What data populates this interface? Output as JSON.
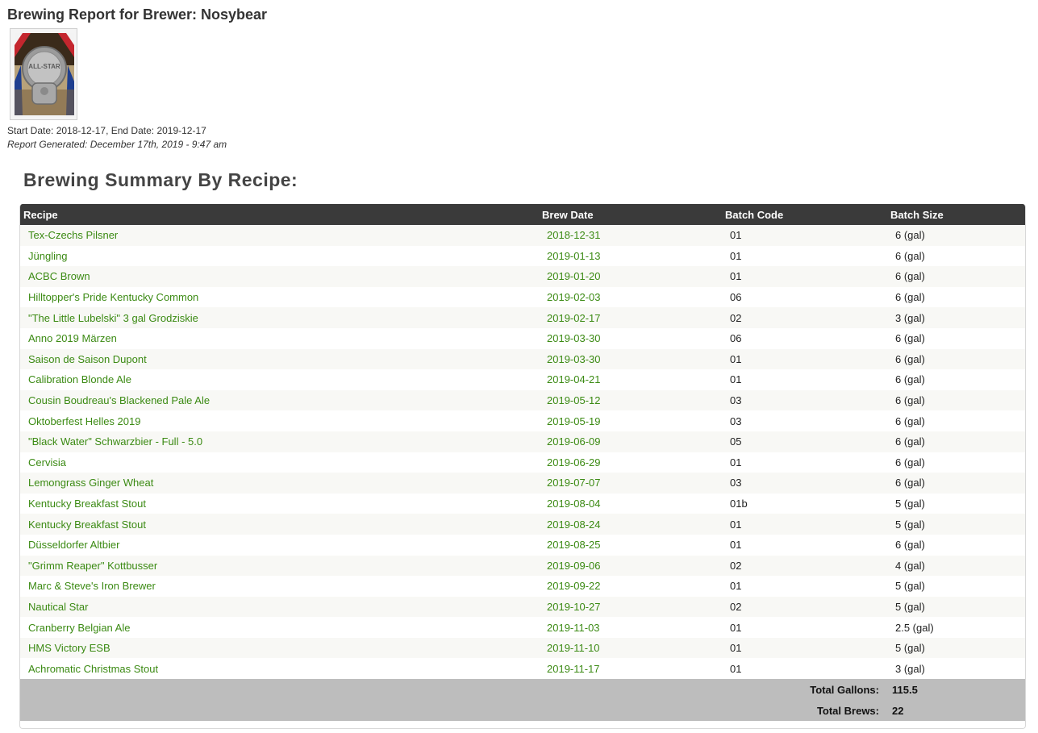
{
  "page": {
    "title": "Brewing Report for Brewer: Nosybear",
    "date_range": "Start Date: 2018-12-17, End Date: 2019-12-17",
    "generated": "Report Generated: December 17th, 2019 - 9:47 am",
    "medal_text": "ALL-STAR"
  },
  "summary": {
    "heading": "Brewing Summary By Recipe:",
    "columns": [
      "Recipe",
      "Brew Date",
      "Batch Code",
      "Batch Size"
    ],
    "rows": [
      [
        "Tex-Czechs Pilsner",
        "2018-12-31",
        "01",
        "6 (gal)"
      ],
      [
        "Jüngling",
        "2019-01-13",
        "01",
        "6 (gal)"
      ],
      [
        "ACBC Brown",
        "2019-01-20",
        "01",
        "6 (gal)"
      ],
      [
        "Hilltopper's Pride Kentucky Common",
        "2019-02-03",
        "06",
        "6 (gal)"
      ],
      [
        "\"The Little Lubelski\" 3 gal Grodziskie",
        "2019-02-17",
        "02",
        "3 (gal)"
      ],
      [
        "Anno 2019 Märzen",
        "2019-03-30",
        "06",
        "6 (gal)"
      ],
      [
        "Saison de Saison Dupont",
        "2019-03-30",
        "01",
        "6 (gal)"
      ],
      [
        "Calibration Blonde Ale",
        "2019-04-21",
        "01",
        "6 (gal)"
      ],
      [
        "Cousin Boudreau's Blackened Pale Ale",
        "2019-05-12",
        "03",
        "6 (gal)"
      ],
      [
        "Oktoberfest Helles 2019",
        "2019-05-19",
        "03",
        "6 (gal)"
      ],
      [
        "\"Black Water\" Schwarzbier - Full - 5.0",
        "2019-06-09",
        "05",
        "6 (gal)"
      ],
      [
        "Cervisia",
        "2019-06-29",
        "01",
        "6 (gal)"
      ],
      [
        "Lemongrass Ginger Wheat",
        "2019-07-07",
        "03",
        "6 (gal)"
      ],
      [
        "Kentucky Breakfast Stout",
        "2019-08-04",
        "01b",
        "5 (gal)"
      ],
      [
        "Kentucky Breakfast Stout",
        "2019-08-24",
        "01",
        "5 (gal)"
      ],
      [
        "Düsseldorfer Altbier",
        "2019-08-25",
        "01",
        "6 (gal)"
      ],
      [
        "\"Grimm Reaper\" Kottbusser",
        "2019-09-06",
        "02",
        "4 (gal)"
      ],
      [
        "Marc & Steve's Iron Brewer",
        "2019-09-22",
        "01",
        "5 (gal)"
      ],
      [
        "Nautical Star",
        "2019-10-27",
        "02",
        "5 (gal)"
      ],
      [
        "Cranberry Belgian Ale",
        "2019-11-03",
        "01",
        "2.5 (gal)"
      ],
      [
        "HMS Victory ESB",
        "2019-11-10",
        "01",
        "5 (gal)"
      ],
      [
        "Achromatic Christmas Stout",
        "2019-11-17",
        "01",
        "3 (gal)"
      ]
    ],
    "totals": {
      "gallons_label": "Total Gallons:",
      "gallons_value": "115.5",
      "brews_label": "Total Brews:",
      "brews_value": "22"
    }
  },
  "colors": {
    "link": "#3b8a13",
    "header_bg": "#3a3a3a",
    "footer_bg": "#bdbdbd"
  }
}
